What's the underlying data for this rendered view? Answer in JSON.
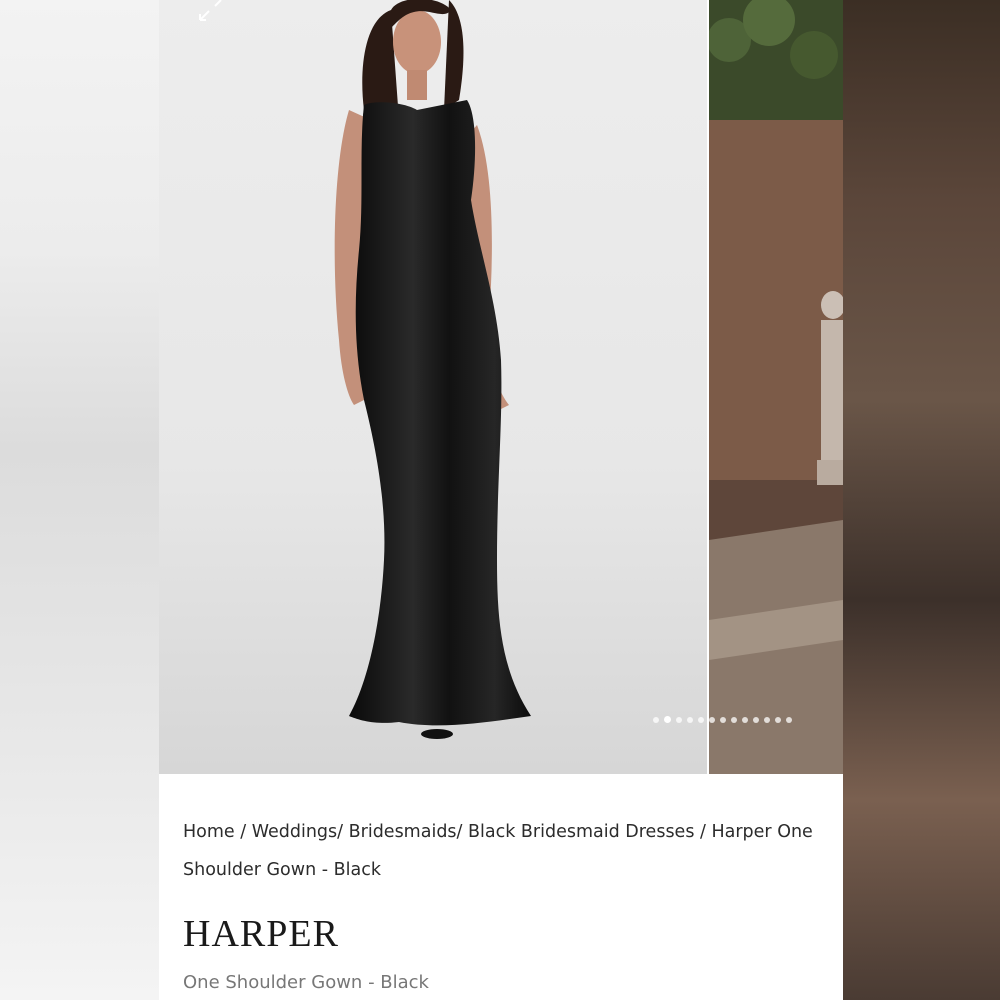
{
  "breadcrumb": {
    "home": "Home",
    "sep1": " / ",
    "weddings": "Weddings/",
    "bridesmaids": " Bridesmaids/",
    "black_bridesmaid": " Black Bridesmaid Dresses",
    "sep2": " / ",
    "current": "Harper One Shoulder Gown - Black"
  },
  "product": {
    "name": "HARPER",
    "subtitle": "One Shoulder Gown - Black"
  },
  "gallery": {
    "image_count": 13,
    "active_index": 1,
    "expand_icon": "expand-arrows-icon"
  },
  "colors": {
    "dress": "#0e0e0e",
    "background": "#ececec",
    "text": "#2c2c2c",
    "muted_text": "#777777"
  }
}
